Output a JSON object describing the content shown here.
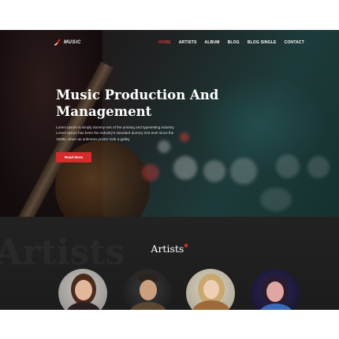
{
  "brand": {
    "name": "MUSIC",
    "accent": "#d62b2b"
  },
  "nav": {
    "items": [
      {
        "label": "HOME",
        "active": true
      },
      {
        "label": "ARTISTS",
        "active": false
      },
      {
        "label": "ALBUM",
        "active": false
      },
      {
        "label": "BLOG",
        "active": false
      },
      {
        "label": "BLOG SINGLE",
        "active": false
      },
      {
        "label": "CONTACT",
        "active": false
      }
    ]
  },
  "hero": {
    "title_line1": "Music Production And",
    "title_line2": "Management",
    "text_line1": "Lorem Ipsum is simply dummy text of the printing and typesetting industry.",
    "text_line2": "Lorem Ipsum has been the industry's standard dummy text ever since the",
    "text_line3": "1500s, when an unknown printer took a galley",
    "button": "Read More"
  },
  "artists": {
    "watermark": "Artists",
    "title": "Artists"
  }
}
